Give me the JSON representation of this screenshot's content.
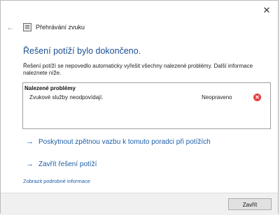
{
  "window": {
    "close_label": "✕"
  },
  "nav": {
    "title": "Přehrávání zvuku"
  },
  "main": {
    "heading": "Řešení potíží bylo dokončeno.",
    "description": "Řešení potíží se nepovedlo automaticky vyřešit všechny nalezené problémy. Další informace naleznete níže."
  },
  "problems": {
    "header": "Nalezené problémy",
    "items": [
      {
        "name": "Zvukové služby neodpovídají.",
        "status": "Neopraveno",
        "icon": "error-icon"
      }
    ]
  },
  "links": {
    "feedback": "Poskytnout zpětnou vazbu k tomuto poradci při potížích",
    "close_troubleshooter": "Zavřít řešení potíží",
    "details": "Zobrazit podrobné informace"
  },
  "footer": {
    "close_button": "Zavřít"
  },
  "colors": {
    "heading": "#1b4f93",
    "link": "#1c5ea8",
    "error": "#e34040"
  }
}
